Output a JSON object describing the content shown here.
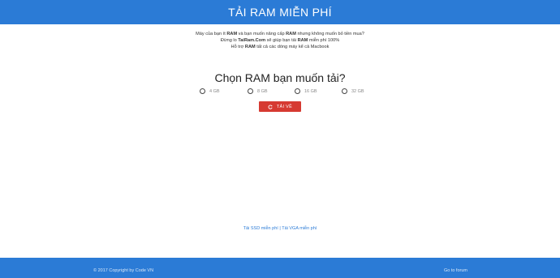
{
  "header": {
    "title": "TẢI RAM MIỄN PHÍ"
  },
  "intro": {
    "line1_pre": "Máy của bạn ít ",
    "line1_b1": "RAM",
    "line1_mid": " và bạn muốn nâng cấp ",
    "line1_b2": "RAM",
    "line1_post": " nhưng không muốn bỏ tiền mua?",
    "line2_pre": "Đừng lo ",
    "line2_b1": "TaiRam.Com",
    "line2_mid": " sẽ giúp bạn tải ",
    "line2_b2": "RAM",
    "line2_post": " miễn phí 100%",
    "line3_pre": "Hỗ trợ ",
    "line3_b1": "RAM",
    "line3_post": " tất cả các dòng máy kể cả Macbook"
  },
  "question": "Chọn RAM bạn muốn tải?",
  "options": [
    {
      "label": "4 GB"
    },
    {
      "label": "8 GB"
    },
    {
      "label": "16 GB"
    },
    {
      "label": "32 GB"
    }
  ],
  "download_button": {
    "label": "TẢI VỀ",
    "icon": "refresh-icon"
  },
  "links": {
    "ssd": "Tải SSD miễn phí",
    "separator": "|",
    "vga": "Tải VGA miễn phí"
  },
  "footer": {
    "copyright": "© 2017 Copyright by Code VN",
    "forum": "Go to forum"
  },
  "colors": {
    "primary": "#2b7bd6",
    "button": "#d63a32",
    "background": "#ffffff"
  }
}
